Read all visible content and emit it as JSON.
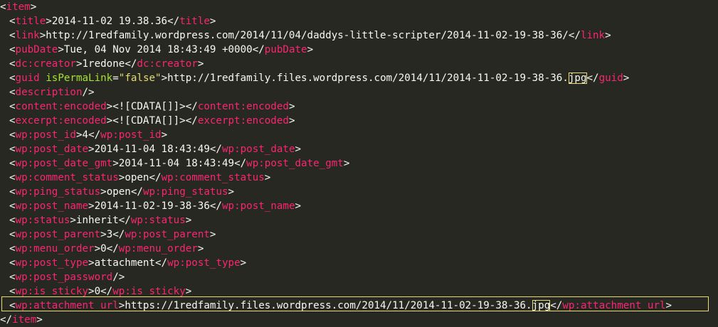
{
  "lines": [
    {
      "type": "open",
      "tag": "item",
      "indent": 0
    },
    {
      "type": "elem",
      "tag": "title",
      "value": "2014-11-02 19.38.36"
    },
    {
      "type": "elem",
      "tag": "link",
      "value": "http://1redfamily.wordpress.com/2014/11/04/daddys-little-scripter/2014-11-02-19-38-36/"
    },
    {
      "type": "elem",
      "tag": "pubDate",
      "value": "Tue, 04 Nov 2014 18:43:49 +0000"
    },
    {
      "type": "elem",
      "tag": "dc:creator",
      "value": "1redone"
    },
    {
      "type": "guid",
      "tag": "guid",
      "attr_name": "isPermaLink",
      "attr_value": "\"false\"",
      "value_prefix": "http://1redfamily.files.wordpress.com/2014/11/2014-11-02-19-38-36.",
      "value_highlight": "jpg"
    },
    {
      "type": "selfclose",
      "tag": "description"
    },
    {
      "type": "elem",
      "tag": "content:encoded",
      "value": "<![CDATA[]]>"
    },
    {
      "type": "elem",
      "tag": "excerpt:encoded",
      "value": "<![CDATA[]]>"
    },
    {
      "type": "elem",
      "tag": "wp:post_id",
      "value": "4"
    },
    {
      "type": "elem",
      "tag": "wp:post_date",
      "value": "2014-11-04 18:43:49"
    },
    {
      "type": "elem",
      "tag": "wp:post_date_gmt",
      "value": "2014-11-04 18:43:49"
    },
    {
      "type": "elem",
      "tag": "wp:comment_status",
      "value": "open"
    },
    {
      "type": "elem",
      "tag": "wp:ping_status",
      "value": "open"
    },
    {
      "type": "elem",
      "tag": "wp:post_name",
      "value": "2014-11-02-19-38-36"
    },
    {
      "type": "elem",
      "tag": "wp:status",
      "value": "inherit"
    },
    {
      "type": "elem",
      "tag": "wp:post_parent",
      "value": "3"
    },
    {
      "type": "elem",
      "tag": "wp:menu_order",
      "value": "0"
    },
    {
      "type": "elem",
      "tag": "wp:post_type",
      "value": "attachment"
    },
    {
      "type": "selfclose",
      "tag": "wp:post_password"
    },
    {
      "type": "elem",
      "tag": "wp:is_sticky",
      "value": "0"
    },
    {
      "type": "highlight",
      "tag": "wp:attachment_url",
      "value_prefix": "https://1redfamily.files.wordpress.com/2014/11/2014-11-02-19-38-36.",
      "value_highlight": "jpg"
    },
    {
      "type": "close",
      "tag": "item",
      "indent": 0
    }
  ],
  "colors": {
    "background": "#272822",
    "tag": "#f92672",
    "attribute": "#a6e22e",
    "string": "#e6db74",
    "text": "#f8f8f2",
    "highlight_border": "#e6db74"
  }
}
